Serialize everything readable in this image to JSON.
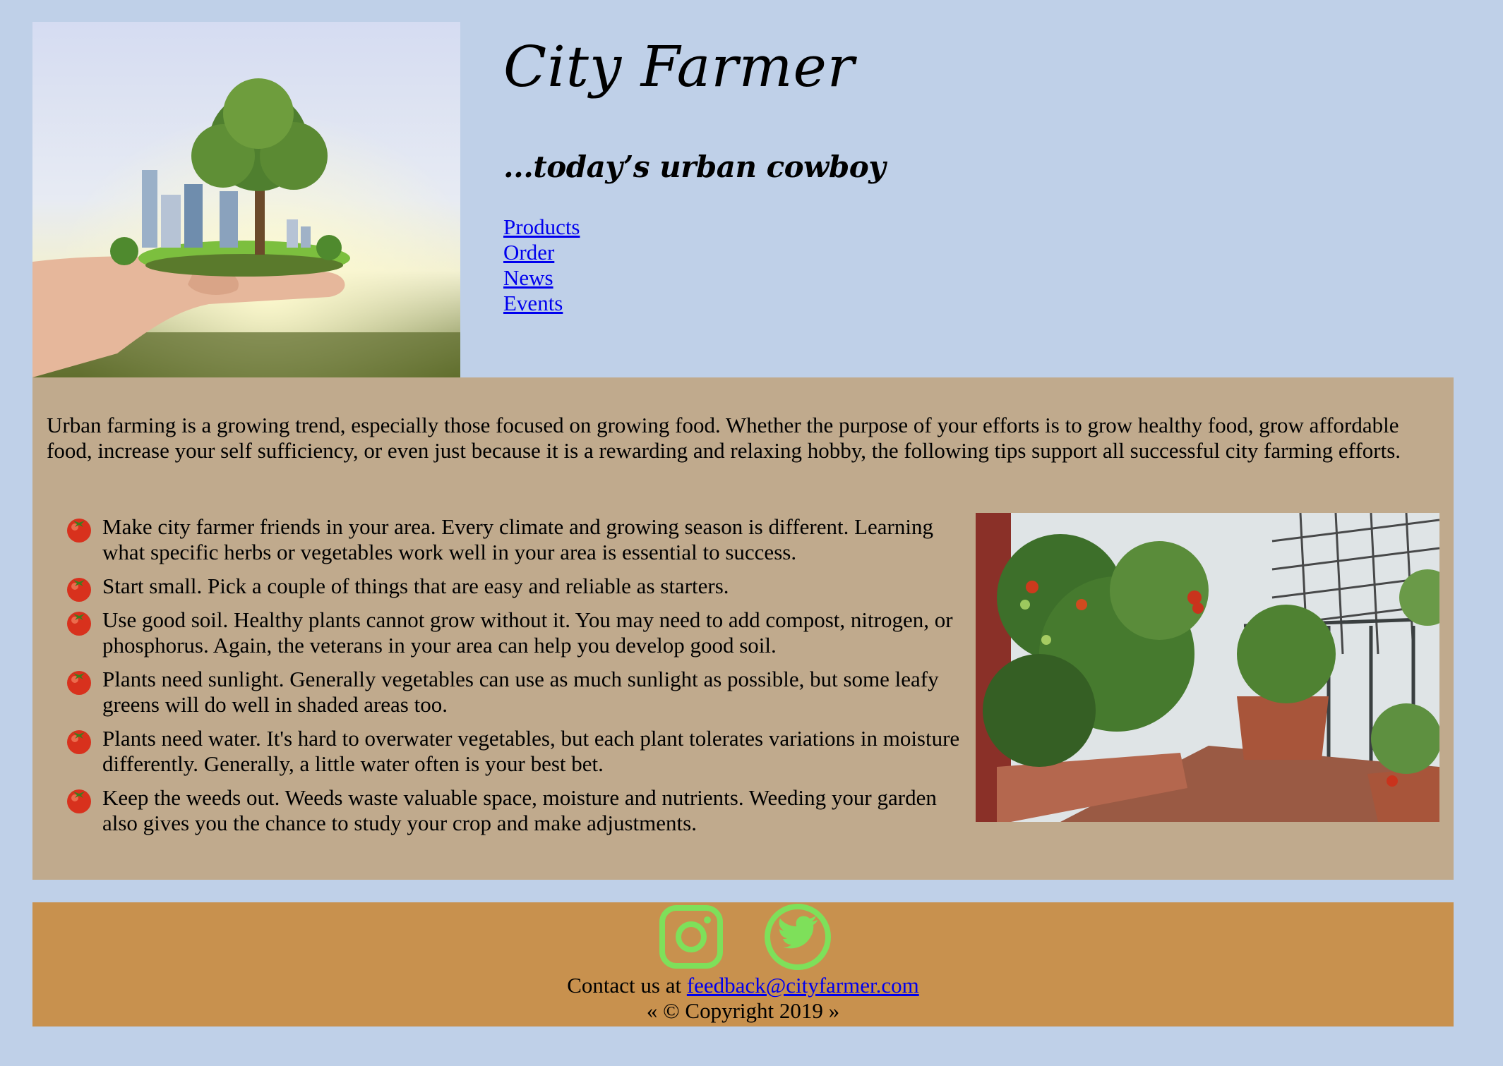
{
  "header": {
    "title": "City Farmer",
    "tagline": "...today’s urban cowboy",
    "hero_image": "hand-holding-city-tree-image"
  },
  "nav": {
    "items": [
      {
        "label": "Products"
      },
      {
        "label": "Order"
      },
      {
        "label": "News"
      },
      {
        "label": "Events"
      }
    ]
  },
  "main": {
    "intro": "Urban farming is a growing trend, especially those focused on growing food. Whether the purpose of your efforts is to grow healthy food, grow affordable food, increase your self sufficiency, or even just because it is a rewarding and relaxing hobby, the following tips support all successful city farming efforts.",
    "tips": [
      "Make city farmer friends in your area. Every climate and growing season is different. Learning what specific herbs or vegetables work well in your area is essential to success.",
      "Start small. Pick a couple of things that are easy and reliable as starters.",
      "Use good soil. Healthy plants cannot grow without it. You may need to add compost, nitrogen, or phosphorus. Again, the veterans in your area can help you develop good soil.",
      "Plants need sunlight. Generally vegetables can use as much sunlight as possible, but some leafy greens will do well in shaded areas too.",
      "Plants need water. It's hard to overwater vegetables, but each plant tolerates variations in moisture differently. Generally, a little water often is your best bet.",
      "Keep the weeds out. Weeds waste valuable space, moisture and nutrients. Weeding your garden also gives you the chance to study your crop and make adjustments."
    ],
    "bullet_icon": "tomato-icon",
    "side_image": "balcony-tomato-garden-image"
  },
  "footer": {
    "social": [
      {
        "icon": "instagram-icon"
      },
      {
        "icon": "twitter-icon"
      }
    ],
    "contact_prefix": "Contact us at",
    "contact_email": "feedback@cityfarmer.com",
    "copyright": "« © Copyright 2019 »"
  },
  "colors": {
    "page_bg": "#bfd0e8",
    "main_bg": "#c0aa8d",
    "footer_bg": "#c8914e",
    "link": "#0000ee",
    "social_icon": "#7ee05a"
  }
}
